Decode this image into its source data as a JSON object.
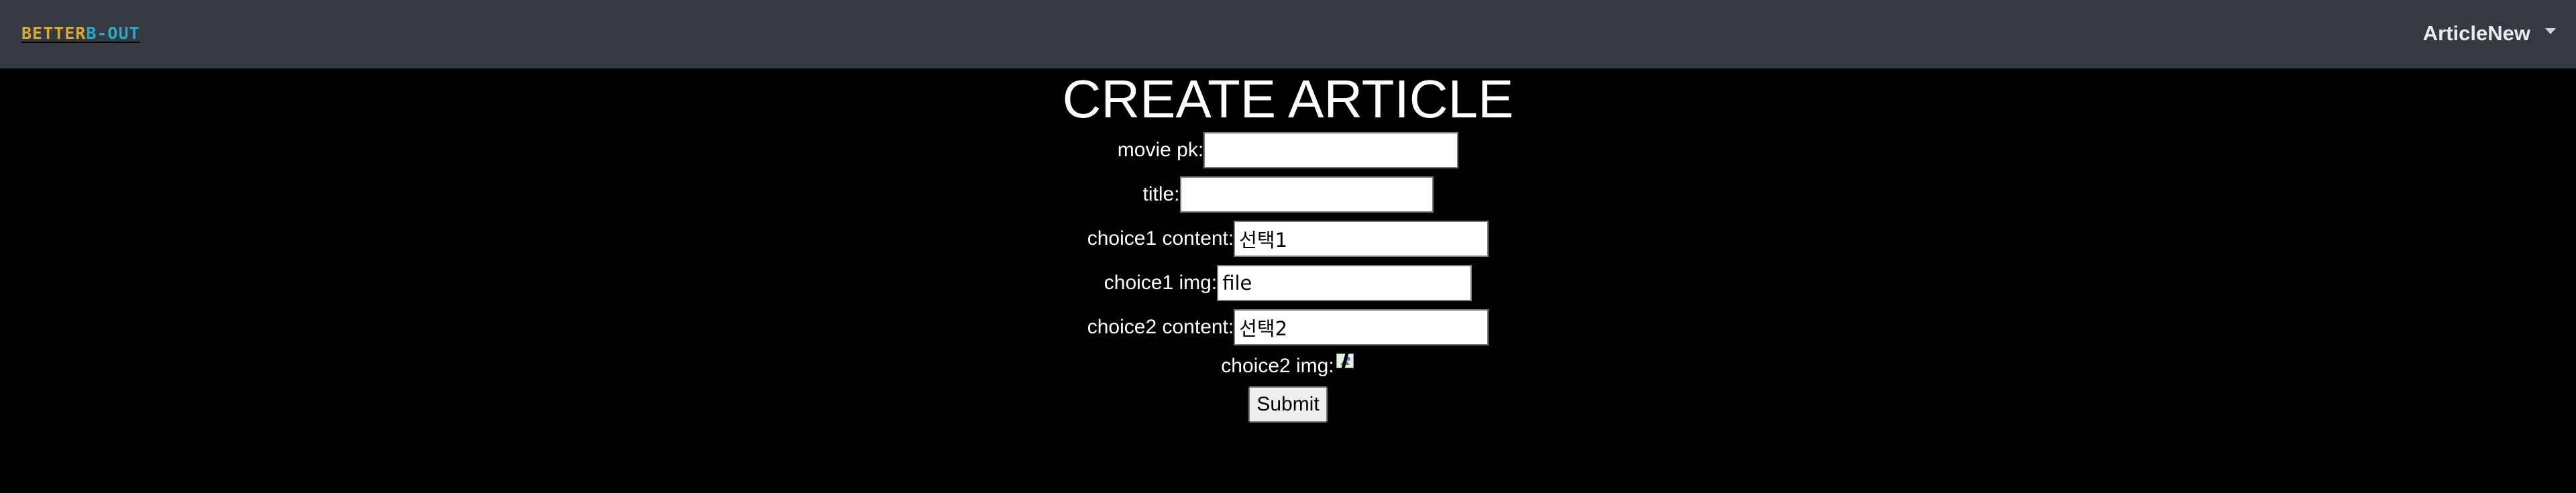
{
  "navbar": {
    "brand_part1": "BETTER",
    "brand_part2": "B-OUT",
    "user_label": "ArticleNew",
    "colors": {
      "background": "#343a40",
      "brand_gold": "#d9a93a",
      "brand_blue": "#2ea6c9"
    },
    "caret_icon": "caret-down-icon"
  },
  "page": {
    "title": "CREATE ARTICLE",
    "background_color": "#000000"
  },
  "form": {
    "movie_pk": {
      "label": "movie pk:",
      "value": ""
    },
    "title": {
      "label": "title:",
      "value": ""
    },
    "choice1_content": {
      "label": "choice1 content:",
      "value": "선택1"
    },
    "choice1_img": {
      "label": "choice1 img:",
      "value": "file"
    },
    "choice2_content": {
      "label": "choice2 content:",
      "value": "선택2"
    },
    "choice2_img": {
      "label": "choice2 img:",
      "image_icon": "broken-image-icon"
    },
    "submit_label": "Submit"
  }
}
